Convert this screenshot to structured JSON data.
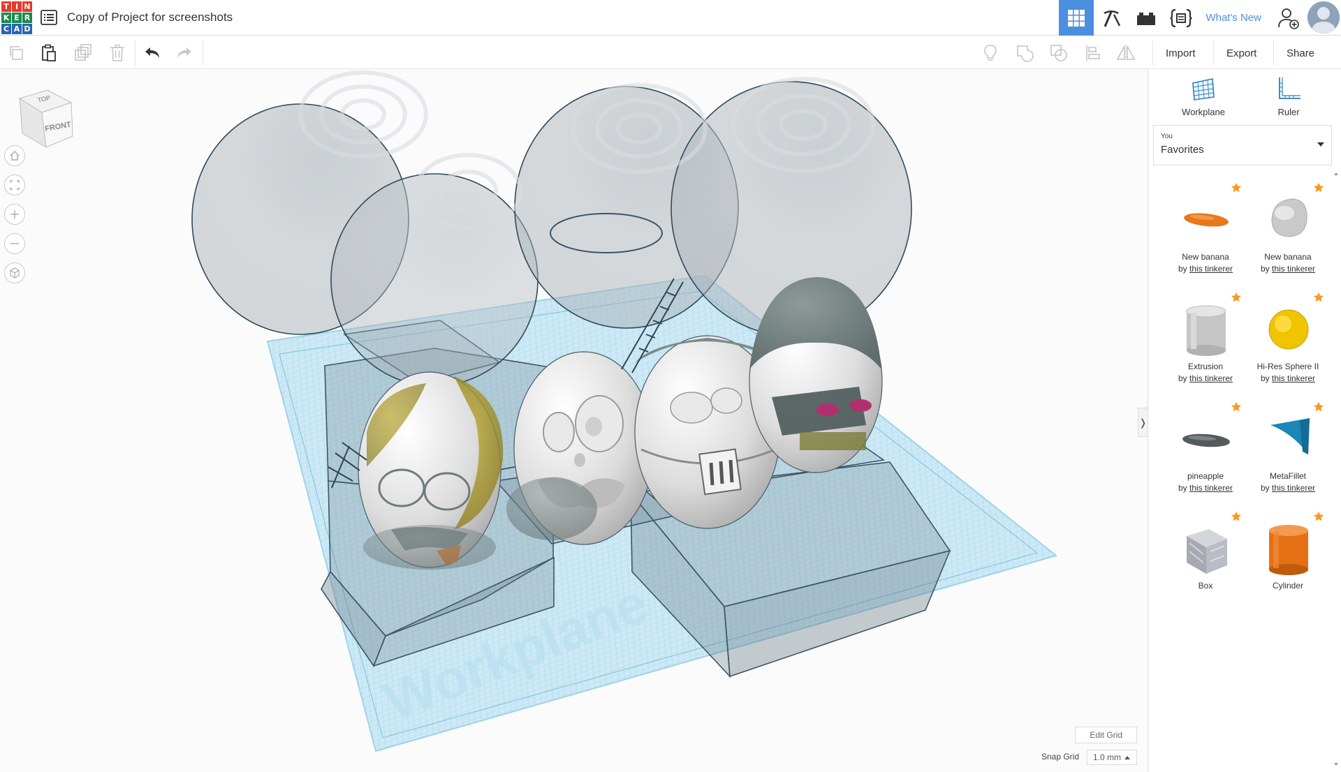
{
  "app": {
    "logo_letters": [
      "T",
      "I",
      "N",
      "K",
      "E",
      "R",
      "C",
      "A",
      "D"
    ],
    "logo_colors": [
      "#e8392a",
      "#e8392a",
      "#e8392a",
      "#1b8a4a",
      "#1b8a4a",
      "#1b8a4a",
      "#2467b3",
      "#2467b3",
      "#2467b3"
    ],
    "document_title": "Copy of Project for screenshots",
    "whats_new": "What's New"
  },
  "top_right": {
    "items": [
      {
        "icon": "3d-design-grid-icon",
        "active": true
      },
      {
        "icon": "pickaxe-icon",
        "active": false
      },
      {
        "icon": "bricks-icon",
        "active": false
      },
      {
        "icon": "codeblocks-icon",
        "active": false
      }
    ]
  },
  "toolbar": {
    "import_label": "Import",
    "export_label": "Export",
    "share_label": "Share"
  },
  "viewport": {
    "viewcube_top": "TOP",
    "viewcube_front": "FRONT",
    "workplane_watermark": "Workplane",
    "edit_grid_label": "Edit Grid",
    "snap_grid_label": "Snap Grid",
    "snap_grid_value": "1.0 mm",
    "collapse_glyph": "❭"
  },
  "panel": {
    "workplane_label": "Workplane",
    "ruler_label": "Ruler",
    "library_owner": "You",
    "library_name": "Favorites",
    "by_prefix": "by",
    "shapes": [
      {
        "name": "New banana",
        "author": "this tinkerer",
        "color": "#e8781a",
        "kind": "banana-orange"
      },
      {
        "name": "New banana",
        "author": "this tinkerer",
        "color": "#c9c9c9",
        "kind": "banana-grey"
      },
      {
        "name": "Extrusion",
        "author": "this tinkerer",
        "color": "#c6c6c6",
        "kind": "extrusion"
      },
      {
        "name": "Hi-Res Sphere II",
        "author": "this tinkerer",
        "color": "#f0c400",
        "kind": "sphere"
      },
      {
        "name": "pineapple",
        "author": "this tinkerer",
        "color": "#555a5c",
        "kind": "pineapple"
      },
      {
        "name": "MetaFillet",
        "author": "this tinkerer",
        "color": "#1b86b8",
        "kind": "metafillet"
      },
      {
        "name": "Box",
        "author": "",
        "color": "#b9bcc4",
        "kind": "box"
      },
      {
        "name": "Cylinder",
        "author": "",
        "color": "#e56f14",
        "kind": "cylinder"
      }
    ]
  }
}
